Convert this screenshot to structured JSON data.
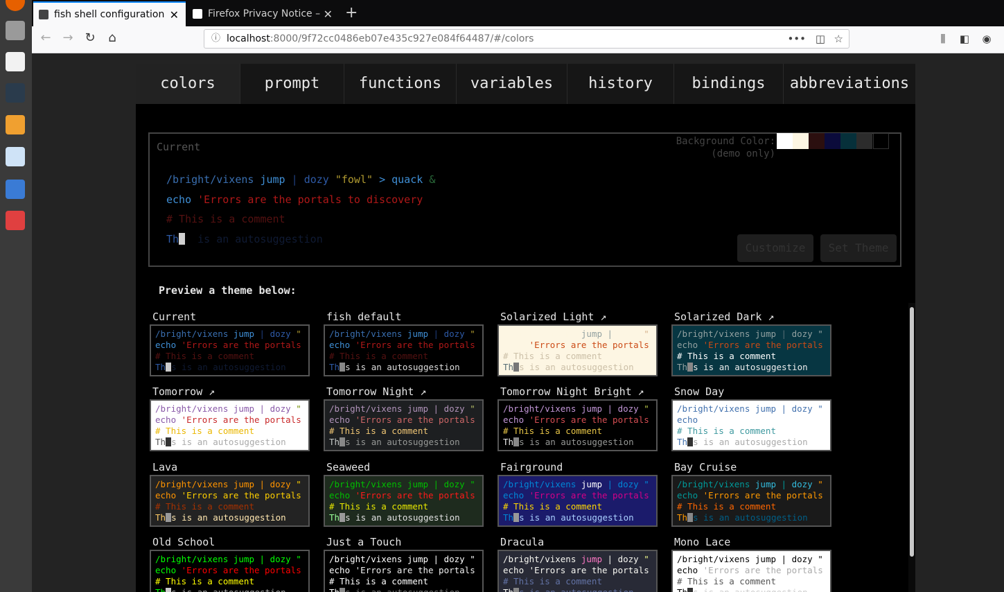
{
  "browser": {
    "tabs": [
      {
        "title": "fish shell configuration",
        "active": true,
        "favicon": "fish-page-icon"
      },
      {
        "title": "Firefox Privacy Notice –",
        "active": false,
        "favicon": "mozilla-m-icon"
      }
    ],
    "url_host": "localhost",
    "url_rest": ":8000/9f72cc0486eb07e435c927e084f64487/#/colors"
  },
  "nav_tabs": [
    "colors",
    "prompt",
    "functions",
    "variables",
    "history",
    "bindings",
    "abbreviations"
  ],
  "current_theme": {
    "label": "Current",
    "bg_label_1": "Background Color:",
    "bg_label_2": "(demo only)",
    "swatches": [
      "#ffffff",
      "#fdf6e3",
      "#2b0f0f",
      "#0b0b3b",
      "#06303a",
      "#2c2c2c",
      "#000000"
    ],
    "line1": {
      "path": "/bright/vixens",
      "cmd": "jump",
      "pipe": "|",
      "cmd2": "dozy",
      "quote": "\"fowl\"",
      "redirect": ">",
      "word": "quack",
      "amp": "&"
    },
    "line2": {
      "cmd": "echo",
      "error": "'Errors are the portals to discovery"
    },
    "line3": "# This is a comment",
    "line4": {
      "typed": "Th",
      "suggest": "is an autosuggestion"
    },
    "customize_label": "Customize",
    "set_theme_label": "Set Theme"
  },
  "preview_label": "Preview a theme below:",
  "demo_text": {
    "line1": {
      "path": "/bright/vixens",
      "jump": "jump",
      "pipe": "|",
      "dozy": "dozy",
      "quote": "\""
    },
    "line2": {
      "echo": "echo",
      "error": "'Errors are the portals"
    },
    "comment": "# This is a comment",
    "typed_a": "Th",
    "typed_b": "s",
    "suggest": "is an autosuggestion"
  },
  "themes": [
    {
      "name": "Current",
      "bg": "#000000",
      "path": "#3a6fb0",
      "jump": "#3f8fd6",
      "pipe": "#1f3f7f",
      "dozy": "#2e5aa6",
      "quote": "#b09a30",
      "echo": "#3f8fd6",
      "err": "#b01818",
      "cmt": "#551111",
      "typed": "#2e5aa6",
      "sug": "#0f1a33",
      "cur": "#cccccc"
    },
    {
      "name": "fish default",
      "bg": "#000000",
      "path": "#3a6fb0",
      "jump": "#3f8fd6",
      "pipe": "#1f3f7f",
      "dozy": "#2e5aa6",
      "quote": "#b09a30",
      "echo": "#3f8fd6",
      "err": "#b01818",
      "cmt": "#551111",
      "typed": "#2e5aa6",
      "sug": "#dddddd",
      "cur": "#888888"
    },
    {
      "name": "Solarized Light ↗",
      "bg": "#fdf6e3",
      "path": "#fdf6e3",
      "jump": "#93a1a1",
      "pipe": "#93a1a1",
      "dozy": "#fdf6e3",
      "quote": "#d6b38f",
      "echo": "#fdf6e3",
      "err": "#cb4b16",
      "cmt": "#ccc0a8",
      "typed": "#586e75",
      "sug": "#ccc0a8",
      "cur": "#777777"
    },
    {
      "name": "Solarized Dark ↗",
      "bg": "#073642",
      "path": "#93a1a1",
      "jump": "#93a1a1",
      "pipe": "#586e75",
      "dozy": "#93a1a1",
      "quote": "#93a1a1",
      "echo": "#93a1a1",
      "err": "#cb4b16",
      "cmt": "#ffffff",
      "typed": "#93a1a1",
      "sug": "#eeeeee",
      "cur": "#888888"
    },
    {
      "name": "Tomorrow ↗",
      "bg": "#ffffff",
      "path": "#8959a8",
      "jump": "#8959a8",
      "pipe": "#8959a8",
      "dozy": "#8959a8",
      "quote": "#718c00",
      "echo": "#8959a8",
      "err": "#c82829",
      "cmt": "#eab700",
      "typed": "#555555",
      "sug": "#aaaaaa",
      "cur": "#333333"
    },
    {
      "name": "Tomorrow Night ↗",
      "bg": "#1d1f21",
      "path": "#b294bb",
      "jump": "#b294bb",
      "pipe": "#b294bb",
      "dozy": "#b294bb",
      "quote": "#b5bd68",
      "echo": "#b294bb",
      "err": "#cc6666",
      "cmt": "#f0c674",
      "typed": "#c5c8c6",
      "sug": "#969896",
      "cur": "#888888"
    },
    {
      "name": "Tomorrow Night Bright ↗",
      "bg": "#000000",
      "path": "#c397d8",
      "jump": "#c397d8",
      "pipe": "#c397d8",
      "dozy": "#c397d8",
      "quote": "#b9ca4a",
      "echo": "#c397d8",
      "err": "#d54e53",
      "cmt": "#e7c547",
      "typed": "#eaeaea",
      "sug": "#969896",
      "cur": "#888888"
    },
    {
      "name": "Snow Day",
      "bg": "#ffffff",
      "path": "#4271ae",
      "jump": "#4271ae",
      "pipe": "#4271ae",
      "dozy": "#4271ae",
      "quote": "#4271ae",
      "echo": "#4271ae",
      "err": "#ffffff",
      "cmt": "#3e999f",
      "typed": "#4271ae",
      "sug": "#aaaaaa",
      "cur": "#333333"
    },
    {
      "name": "Lava",
      "bg": "#232323",
      "path": "#ff9400",
      "jump": "#ff9400",
      "pipe": "#ff9400",
      "dozy": "#ff9400",
      "quote": "#ffd000",
      "echo": "#ff9400",
      "err": "#ffd000",
      "cmt": "#a63100",
      "typed": "#ffcc66",
      "sug": "#ffe7b0",
      "cur": "#999999"
    },
    {
      "name": "Seaweed",
      "bg": "#1e2b1e",
      "path": "#00bf00",
      "jump": "#00bf00",
      "pipe": "#00bf00",
      "dozy": "#00bf00",
      "quote": "#00bf00",
      "echo": "#00bf00",
      "err": "#ff1a1a",
      "cmt": "#e8e800",
      "typed": "#99ff99",
      "sug": "#e0e0e0",
      "cur": "#999999"
    },
    {
      "name": "Fairground",
      "bg": "#1b1b6b",
      "path": "#0087d7",
      "jump": "#ffffff",
      "pipe": "#0087d7",
      "dozy": "#0087d7",
      "quote": "#0087d7",
      "echo": "#0087d7",
      "err": "#d70087",
      "cmt": "#ffd700",
      "typed": "#0087d7",
      "sug": "#aad0ff",
      "cur": "#999999"
    },
    {
      "name": "Bay Cruise",
      "bg": "#1a1a1a",
      "path": "#009999",
      "jump": "#33bbdd",
      "pipe": "#009999",
      "dozy": "#33bbdd",
      "quote": "#ff9900",
      "echo": "#009999",
      "err": "#ff9900",
      "cmt": "#ff6600",
      "typed": "#ff9900",
      "sug": "#005f87",
      "cur": "#888888"
    },
    {
      "name": "Old School",
      "bg": "#000000",
      "path": "#00ff00",
      "jump": "#00ff00",
      "pipe": "#00ff00",
      "dozy": "#00ff00",
      "quote": "#00ff00",
      "echo": "#00ff00",
      "err": "#ff0000",
      "cmt": "#ffff00",
      "typed": "#00ff00",
      "sug": "#aaaaaa",
      "cur": "#cccccc"
    },
    {
      "name": "Just a Touch",
      "bg": "#000000",
      "path": "#ffffff",
      "jump": "#ffffff",
      "pipe": "#ffffff",
      "dozy": "#ffffff",
      "quote": "#ffffff",
      "echo": "#ffffff",
      "err": "#f0f0f0",
      "cmt": "#ffffff",
      "typed": "#ffffff",
      "sug": "#777777",
      "cur": "#888888"
    },
    {
      "name": "Dracula",
      "bg": "#282a36",
      "path": "#f8f8f2",
      "jump": "#ff79c6",
      "pipe": "#f8f8f2",
      "dozy": "#f8f8f2",
      "quote": "#f1fa8c",
      "echo": "#f8f8f2",
      "err": "#f8f8f2",
      "cmt": "#6272a4",
      "typed": "#f8f8f2",
      "sug": "#6272a4",
      "cur": "#888888"
    },
    {
      "name": "Mono Lace",
      "bg": "#ffffff",
      "path": "#000000",
      "jump": "#000000",
      "pipe": "#000000",
      "dozy": "#000000",
      "quote": "#000000",
      "echo": "#000000",
      "err": "#aaaaaa",
      "cmt": "#555555",
      "typed": "#000000",
      "sug": "#cccccc",
      "cur": "#333333"
    }
  ]
}
